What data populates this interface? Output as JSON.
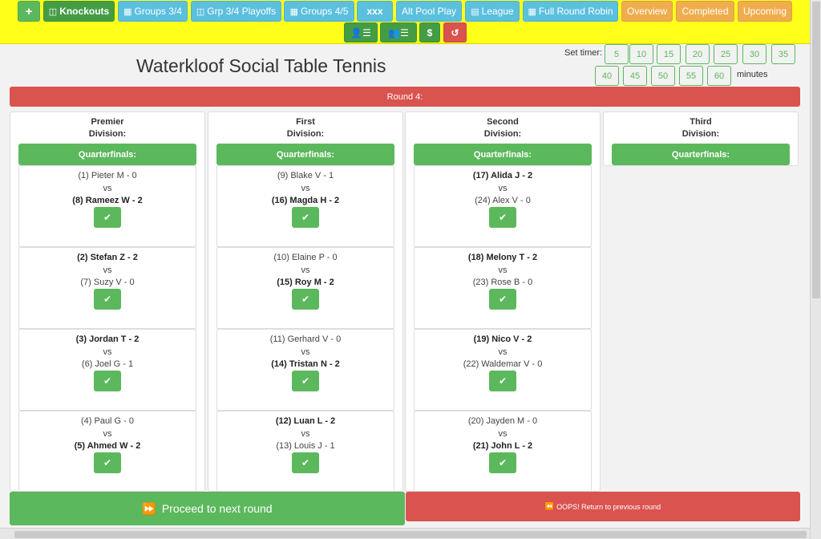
{
  "toolbar": {
    "add_icon": "plus-icon",
    "knockouts": "Knockouts",
    "groups34": "Groups 3/4",
    "grp34playoffs": "Grp 3/4 Playoffs",
    "groups45": "Groups 4/5",
    "xxx": "xxx",
    "altpool": "Alt Pool Play",
    "league": "League",
    "fullrr": "Full Round Robin",
    "overview": "Overview",
    "completed": "Completed",
    "upcoming": "Upcoming",
    "dollar": "$"
  },
  "header": {
    "title": "Waterkloof Social Table Tennis",
    "timer_label": "Set timer:",
    "timer_options": [
      "5",
      "10",
      "15",
      "20",
      "25",
      "30",
      "35",
      "40",
      "45",
      "50",
      "55",
      "60"
    ],
    "minutes_label": "minutes"
  },
  "round": {
    "label": "Round 4:"
  },
  "colors": {
    "green": "#5cb85c",
    "blue": "#5bc0de",
    "orange": "#f0ad4e",
    "red": "#d9534f",
    "yellow": "#ffff1a"
  },
  "divisions": [
    {
      "name1": "Premier",
      "name2": "Division:",
      "stage": "Quarterfinals:",
      "matches": [
        {
          "p1": "(1) Pieter M - 0",
          "p2": "(8) Rameez W - 2",
          "winner": 2
        },
        {
          "p1": "(2) Stefan Z - 2",
          "p2": "(7) Suzy V - 0",
          "winner": 1
        },
        {
          "p1": "(3) Jordan T - 2",
          "p2": "(6) Joel G - 1",
          "winner": 1
        },
        {
          "p1": "(4) Paul G - 0",
          "p2": "(5) Ahmed W - 2",
          "winner": 2
        }
      ]
    },
    {
      "name1": "First",
      "name2": "Division:",
      "stage": "Quarterfinals:",
      "matches": [
        {
          "p1": "(9) Blake V - 1",
          "p2": "(16) Magda H - 2",
          "winner": 2
        },
        {
          "p1": "(10) Elaine P - 0",
          "p2": "(15) Roy M - 2",
          "winner": 2
        },
        {
          "p1": "(11) Gerhard V - 0",
          "p2": "(14) Tristan N - 2",
          "winner": 2
        },
        {
          "p1": "(12) Luan L - 2",
          "p2": "(13) Louis J - 1",
          "winner": 1
        }
      ]
    },
    {
      "name1": "Second",
      "name2": "Division:",
      "stage": "Quarterfinals:",
      "matches": [
        {
          "p1": "(17) Alida J - 2",
          "p2": "(24) Alex V - 0",
          "winner": 1
        },
        {
          "p1": "(18) Melony T - 2",
          "p2": "(23) Rose B - 0",
          "winner": 1
        },
        {
          "p1": "(19) Nico V - 2",
          "p2": "(22) Waldemar V - 0",
          "winner": 1
        },
        {
          "p1": "(20) Jayden M - 0",
          "p2": "(21) John L - 2",
          "winner": 2
        }
      ]
    },
    {
      "name1": "Third",
      "name2": "Division:",
      "stage": "Quarterfinals:",
      "matches": []
    }
  ],
  "footer": {
    "proceed": "Proceed to next round",
    "oops": "OOPS! Return to previous round"
  },
  "vs_label": "vs"
}
